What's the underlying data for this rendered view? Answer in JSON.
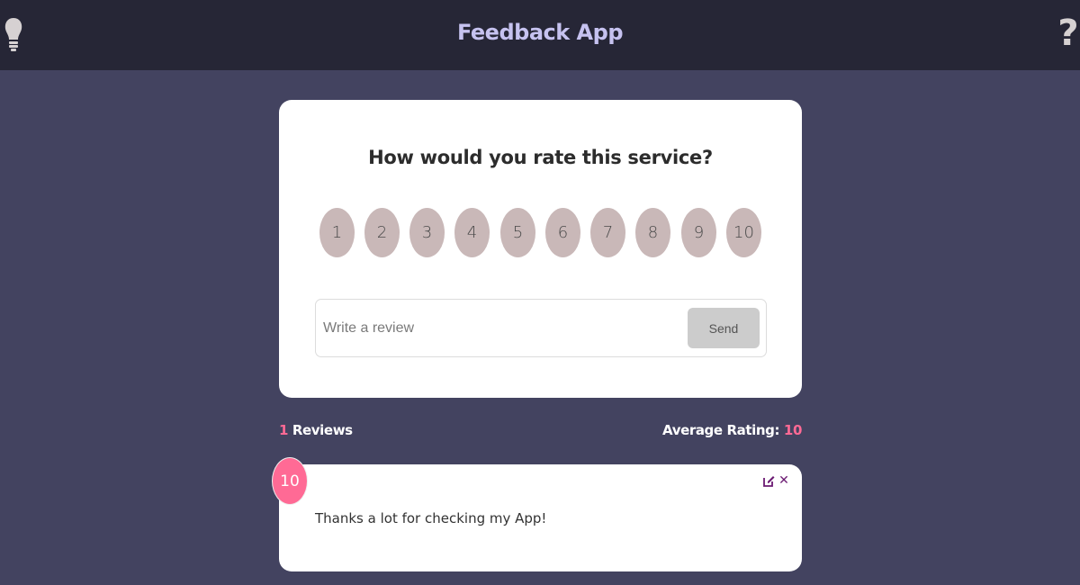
{
  "header": {
    "title": "Feedback App",
    "left_icon": "lightbulb-icon",
    "right_icon": "question-icon",
    "right_icon_glyph": "?"
  },
  "form": {
    "question": "How would you rate this service?",
    "ratings": [
      "1",
      "2",
      "3",
      "4",
      "5",
      "6",
      "7",
      "8",
      "9",
      "10"
    ],
    "review_input": {
      "placeholder": "Write a review",
      "value": ""
    },
    "send_label": "Send"
  },
  "stats": {
    "count": "1",
    "reviews_label": "Reviews",
    "average_label": "Average Rating:",
    "average_value": "10"
  },
  "feedback_items": [
    {
      "rating": "10",
      "text": "Thanks a lot for checking my App!",
      "edit_icon": "edit-icon",
      "close_icon": "close-icon",
      "close_glyph": "✕"
    }
  ],
  "colors": {
    "background": "#434360",
    "header": "#262636",
    "title": "#c6c2f0",
    "accent": "#ff6a95",
    "rating_button": "#c9b8b8",
    "icon_purple": "#6b1a72"
  }
}
